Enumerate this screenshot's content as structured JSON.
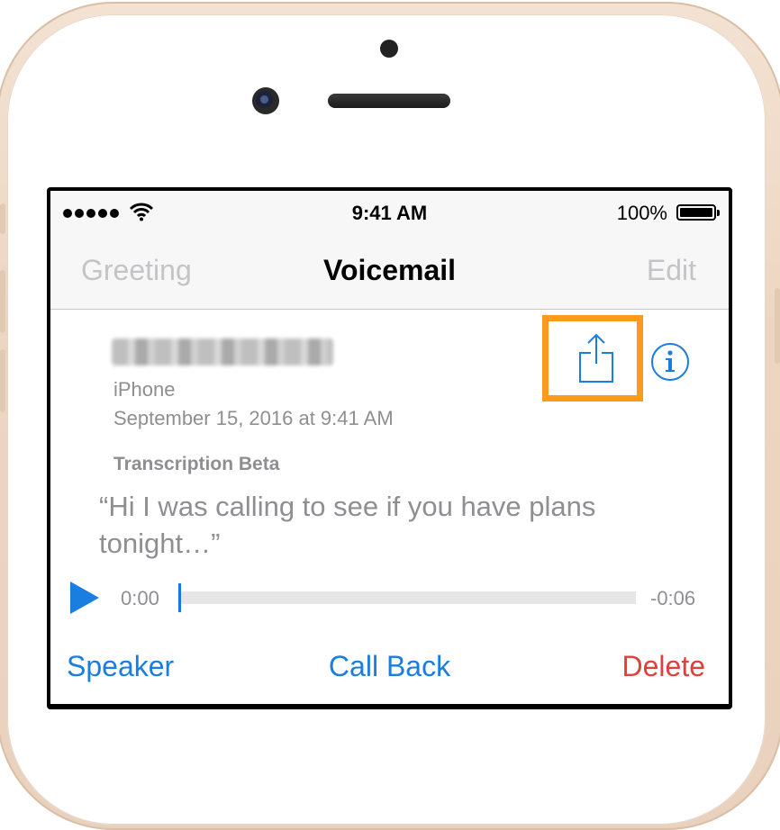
{
  "status_bar": {
    "time": "9:41 AM",
    "battery_percent": "100%",
    "signal_icon": "signal-dots-icon",
    "wifi_icon": "wifi-icon",
    "battery_icon": "battery-icon"
  },
  "nav": {
    "left_label": "Greeting",
    "title": "Voicemail",
    "right_label": "Edit"
  },
  "voicemail": {
    "caller_name": "Jane Appleseed",
    "device": "iPhone",
    "datetime": "September 15, 2016 at 9:41 AM",
    "transcription_label": "Transcription Beta",
    "transcription_text": "“Hi I was calling to see if you have plans tonight…”",
    "time_elapsed": "0:00",
    "time_remaining": "-0:06",
    "progress": 0.0
  },
  "actions": {
    "speaker": "Speaker",
    "call_back": "Call Back",
    "delete": "Delete"
  },
  "colors": {
    "accent": "#1a7ee0",
    "destructive": "#e0403a",
    "highlight": "#fb9a1c",
    "secondary_text": "#8e8e93"
  }
}
